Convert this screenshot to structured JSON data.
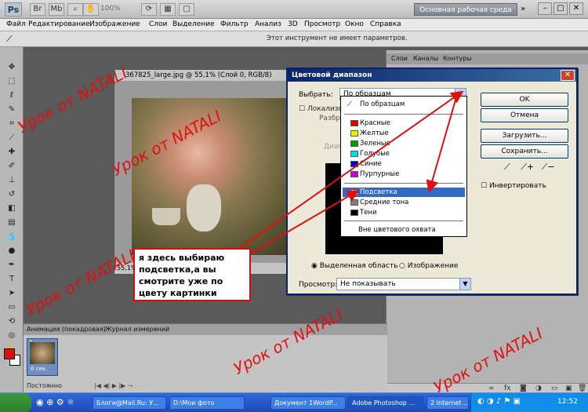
{
  "app": {
    "logo": "Ps",
    "zoom": "100%",
    "workspace": "Основная рабочая среда"
  },
  "menu": [
    "Файл",
    "Редактирование",
    "Изображение",
    "Слои",
    "Выделение",
    "Фильтр",
    "Анализ",
    "3D",
    "Просмотр",
    "Окно",
    "Справка"
  ],
  "options": {
    "message": "Этот инструмент не имеет параметров."
  },
  "document": {
    "title": "367825_large.jpg @ 55,1% (Слой 0, RGB/8)",
    "status": "55,1%"
  },
  "panels": {
    "tabs": [
      "Слои",
      "Каналы",
      "Контуры"
    ]
  },
  "animation": {
    "tab1": "Анимация (покадровая)",
    "tab2": "Журнал измерений",
    "frame_number": "1",
    "frame_duration": "0 сек.",
    "loop": "Постоянно"
  },
  "dialog": {
    "title": "Цветовой диапазон",
    "select_label": "Выбрать:",
    "select_value": "По образцам",
    "localize": "Локализов",
    "scatter": "Разбр",
    "range": "Диапа",
    "radio_selection": "Выделенная область",
    "radio_image": "Изображение",
    "view_label": "Просмотр:",
    "view_value": "Не показывать",
    "btn_ok": "OK",
    "btn_cancel": "Отмена",
    "btn_load": "Загрузить...",
    "btn_save": "Сохранить...",
    "invert": "Инвертировать"
  },
  "dropdown": {
    "items": [
      {
        "label": "По образцам",
        "color": ""
      },
      {
        "label": "Красные",
        "color": "#e00000"
      },
      {
        "label": "Желтые",
        "color": "#f0f000"
      },
      {
        "label": "Зеленые",
        "color": "#00a000"
      },
      {
        "label": "Голубые",
        "color": "#00e0e0"
      },
      {
        "label": "Синие",
        "color": "#0000c0"
      },
      {
        "label": "Пурпурные",
        "color": "#d000d0"
      },
      {
        "label": "Подсветка",
        "color": "#ffffff"
      },
      {
        "label": "Средние тона",
        "color": "#808080"
      },
      {
        "label": "Тени",
        "color": "#000000"
      },
      {
        "label": "Вне цветового охвата",
        "color": ""
      }
    ]
  },
  "callout": {
    "text": "я здесь выбираю подсветка,а вы смотрите уже по цвету картинки"
  },
  "watermark": "Урок от NATALI",
  "taskbar": {
    "items": [
      "Блоги@Mail.Ru: У...",
      "D:\\Мои фото",
      "Документ 1WordP...",
      "Adobe Photoshop ...",
      "2 Internet ..."
    ],
    "clock": "12:52"
  }
}
